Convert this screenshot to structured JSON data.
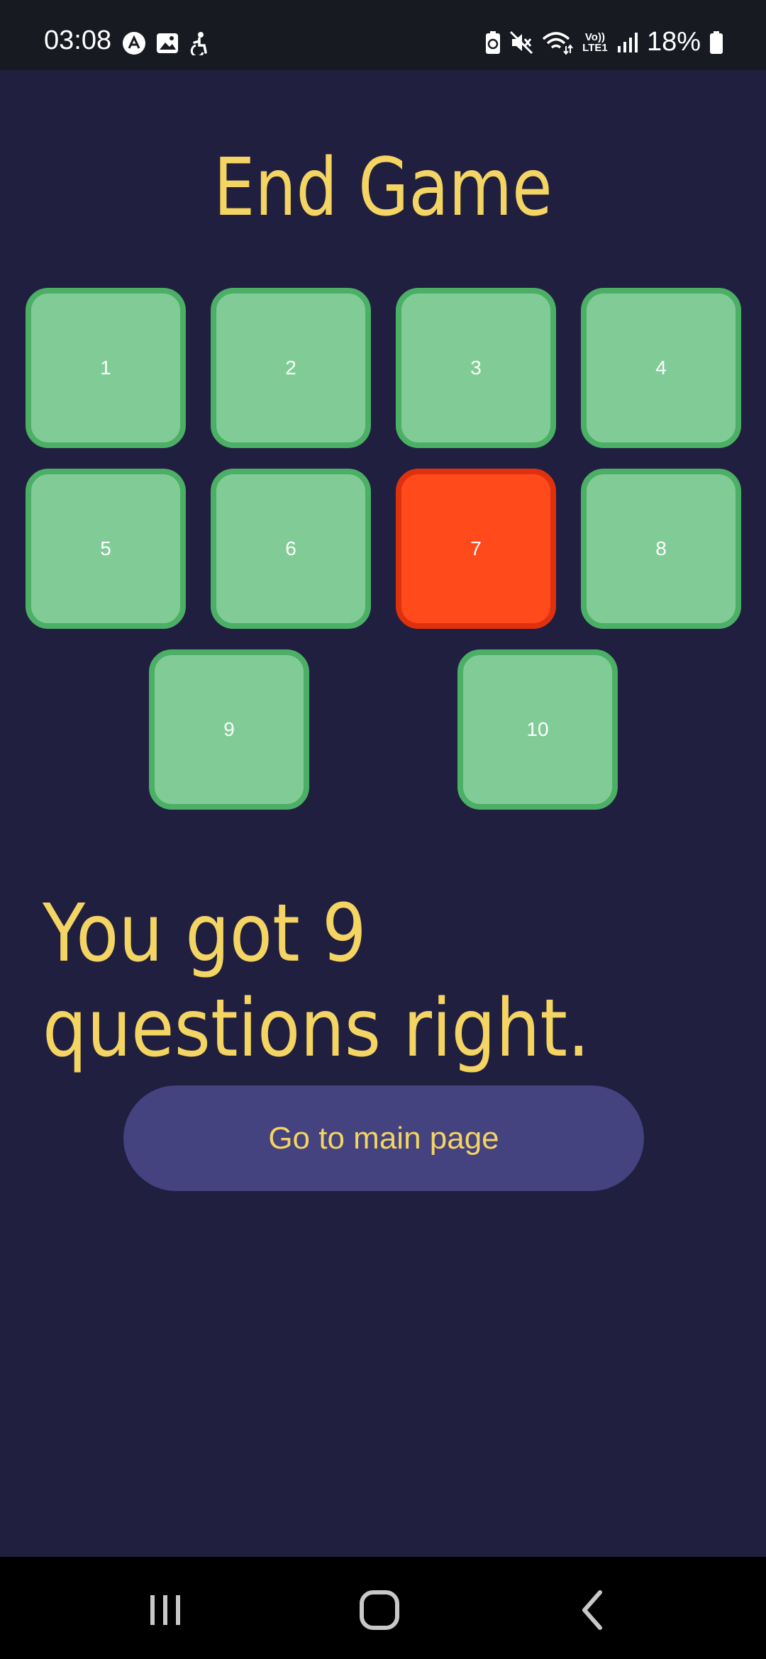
{
  "status_bar": {
    "time": "03:08",
    "battery": "18%",
    "left_icons": [
      "app-a-icon",
      "gallery-icon",
      "accessibility-icon"
    ],
    "right_icons": [
      "battery-saver-icon",
      "mute-icon",
      "wifi-icon",
      "volte-icon",
      "signal-icon",
      "battery-icon"
    ],
    "volte_label": "Vo)) LTE1"
  },
  "page": {
    "title": "End Game",
    "result_text": "You got 9 questions right.",
    "main_button_label": "Go to main page"
  },
  "tiles": [
    {
      "label": "1",
      "status": "correct"
    },
    {
      "label": "2",
      "status": "correct"
    },
    {
      "label": "3",
      "status": "correct"
    },
    {
      "label": "4",
      "status": "correct"
    },
    {
      "label": "5",
      "status": "correct"
    },
    {
      "label": "6",
      "status": "correct"
    },
    {
      "label": "7",
      "status": "wrong"
    },
    {
      "label": "8",
      "status": "correct"
    },
    {
      "label": "9",
      "status": "correct"
    },
    {
      "label": "10",
      "status": "correct"
    }
  ],
  "colors": {
    "background": "#201f3f",
    "accent_text": "#f4d462",
    "correct_fill": "#81cc96",
    "correct_border": "#4caf66",
    "wrong_fill": "#ff4a1c",
    "button_fill": "#44427f"
  },
  "nav_bar": {
    "buttons": [
      "recent-apps-icon",
      "home-icon",
      "back-icon"
    ]
  }
}
